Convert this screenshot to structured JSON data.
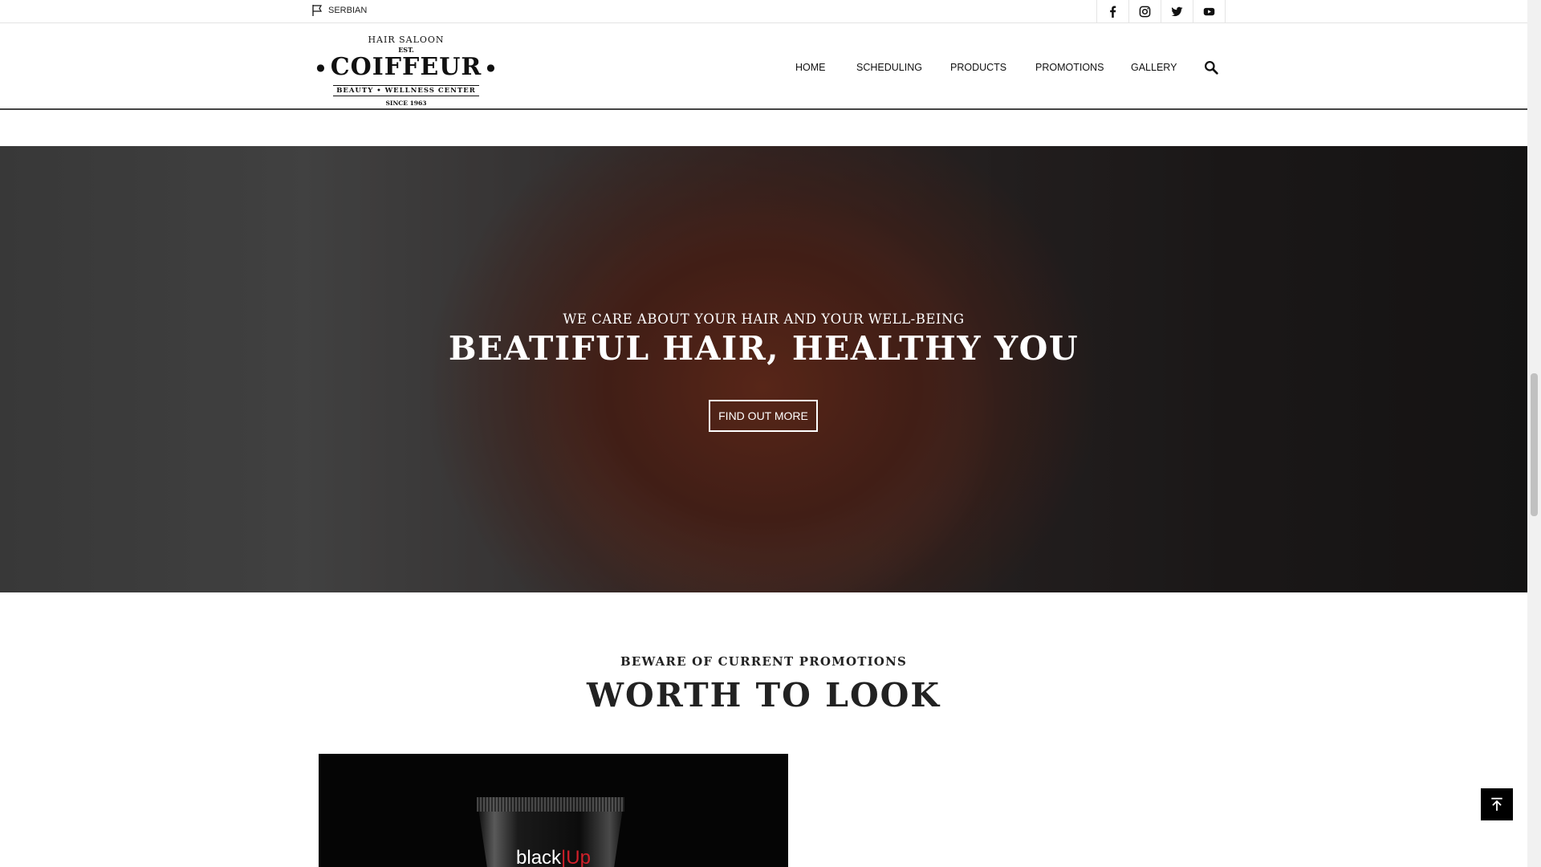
{
  "topbar": {
    "language_label": "SERBIAN",
    "social_icons": [
      "facebook-icon",
      "instagram-icon",
      "twitter-icon",
      "youtube-icon"
    ]
  },
  "logo": {
    "arc_text": "HAIR SALOON",
    "est_text": "EST.",
    "brand": "COIFFEUR",
    "tagline": "BEAUTY • WELLNESS CENTER",
    "since": "SINCE 1963"
  },
  "nav": {
    "items": [
      "HOME",
      "SCHEDULING",
      "PRODUCTS",
      "PROMOTIONS",
      "GALLERY"
    ],
    "search_icon": "search-icon"
  },
  "hero": {
    "subtitle": "WE CARE ABOUT YOUR HAIR AND YOUR WELL-BEING",
    "title": "BEATIFUL HAIR, HEALTHY YOU",
    "cta_label": "FIND OUT MORE"
  },
  "promotions": {
    "subtitle": "BEWARE OF CURRENT PROMOTIONS",
    "title": "WORTH TO LOOK",
    "card": {
      "product_text_black": "black",
      "product_text_sep": "|",
      "product_text_up": "Up"
    }
  },
  "colors": {
    "text_dark": "#222222",
    "accent_red": "#d0202a",
    "white": "#ffffff",
    "black": "#000000"
  },
  "back_to_top_icon": "arrow-up-to-top-icon"
}
